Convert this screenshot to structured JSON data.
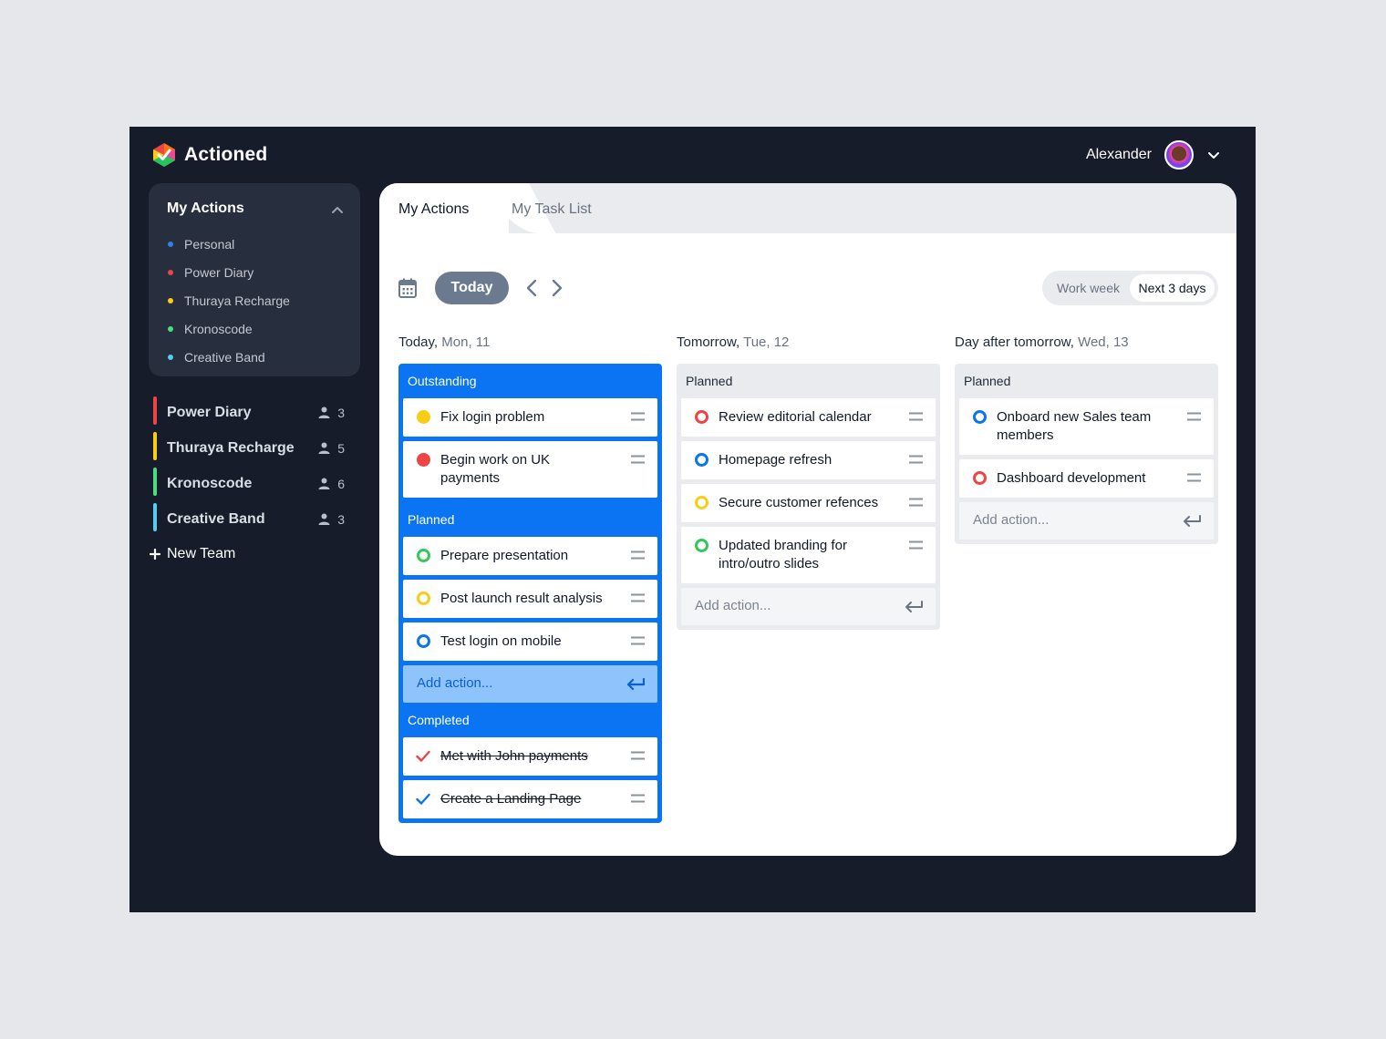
{
  "app": {
    "name": "Actioned"
  },
  "user": {
    "name": "Alexander"
  },
  "sidebar": {
    "my_actions_title": "My Actions",
    "projects": [
      {
        "label": "Personal",
        "color": "#2f80ed"
      },
      {
        "label": "Power Diary",
        "color": "#ef4444"
      },
      {
        "label": "Thuraya Recharge",
        "color": "#facc15"
      },
      {
        "label": "Kronoscode",
        "color": "#4ade80"
      },
      {
        "label": "Creative Band",
        "color": "#56ccf2"
      }
    ],
    "teams": [
      {
        "name": "Power Diary",
        "members": "3",
        "color": "#ef4444"
      },
      {
        "name": "Thuraya Recharge",
        "members": "5",
        "color": "#facc15"
      },
      {
        "name": "Kronoscode",
        "members": "6",
        "color": "#4ade80"
      },
      {
        "name": "Creative Band",
        "members": "3",
        "color": "#56ccf2"
      }
    ],
    "new_team": "New Team"
  },
  "tabs": {
    "active": "My Actions",
    "inactive": "My Task List"
  },
  "toolbar": {
    "today": "Today",
    "view_options": [
      "Work week",
      "Next 3 days"
    ],
    "selected_view": "Next 3 days"
  },
  "columns": [
    {
      "heading": "Today,",
      "date": "Mon, 11",
      "outstanding_label": "Outstanding",
      "outstanding": [
        {
          "title": "Fix login problem",
          "status": "fill",
          "color": "#facc15"
        },
        {
          "title": "Begin work on UK payments",
          "status": "fill",
          "color": "#ef4444"
        }
      ],
      "planned_label": "Planned",
      "planned": [
        {
          "title": "Prepare presentation",
          "status": "ring",
          "color": "#34c759"
        },
        {
          "title": "Post launch result analysis",
          "status": "ring",
          "color": "#facc15"
        },
        {
          "title": "Test login on mobile",
          "status": "ring",
          "color": "#0a74f2"
        }
      ],
      "add_placeholder": "Add action...",
      "completed_label": "Completed",
      "completed": [
        {
          "title": "Met with John payments",
          "color": "#ef4444"
        },
        {
          "title": "Create a Landing Page",
          "color": "#0a74f2"
        }
      ]
    },
    {
      "heading": "Tomorrow,",
      "date": "Tue, 12",
      "planned_label": "Planned",
      "planned": [
        {
          "title": "Review editorial calendar",
          "status": "ring",
          "color": "#ef4444"
        },
        {
          "title": "Homepage refresh",
          "status": "ring",
          "color": "#0a74f2"
        },
        {
          "title": "Secure customer refences",
          "status": "ring",
          "color": "#facc15"
        },
        {
          "title": "Updated branding for intro/outro slides",
          "status": "ring",
          "color": "#34c759"
        }
      ],
      "add_placeholder": "Add action..."
    },
    {
      "heading": "Day after tomorrow,",
      "date": "Wed, 13",
      "planned_label": "Planned",
      "planned": [
        {
          "title": "Onboard new Sales team members",
          "status": "ring",
          "color": "#0a74f2"
        },
        {
          "title": "Dashboard development",
          "status": "ring",
          "color": "#ef4444"
        }
      ],
      "add_placeholder": "Add action..."
    }
  ]
}
